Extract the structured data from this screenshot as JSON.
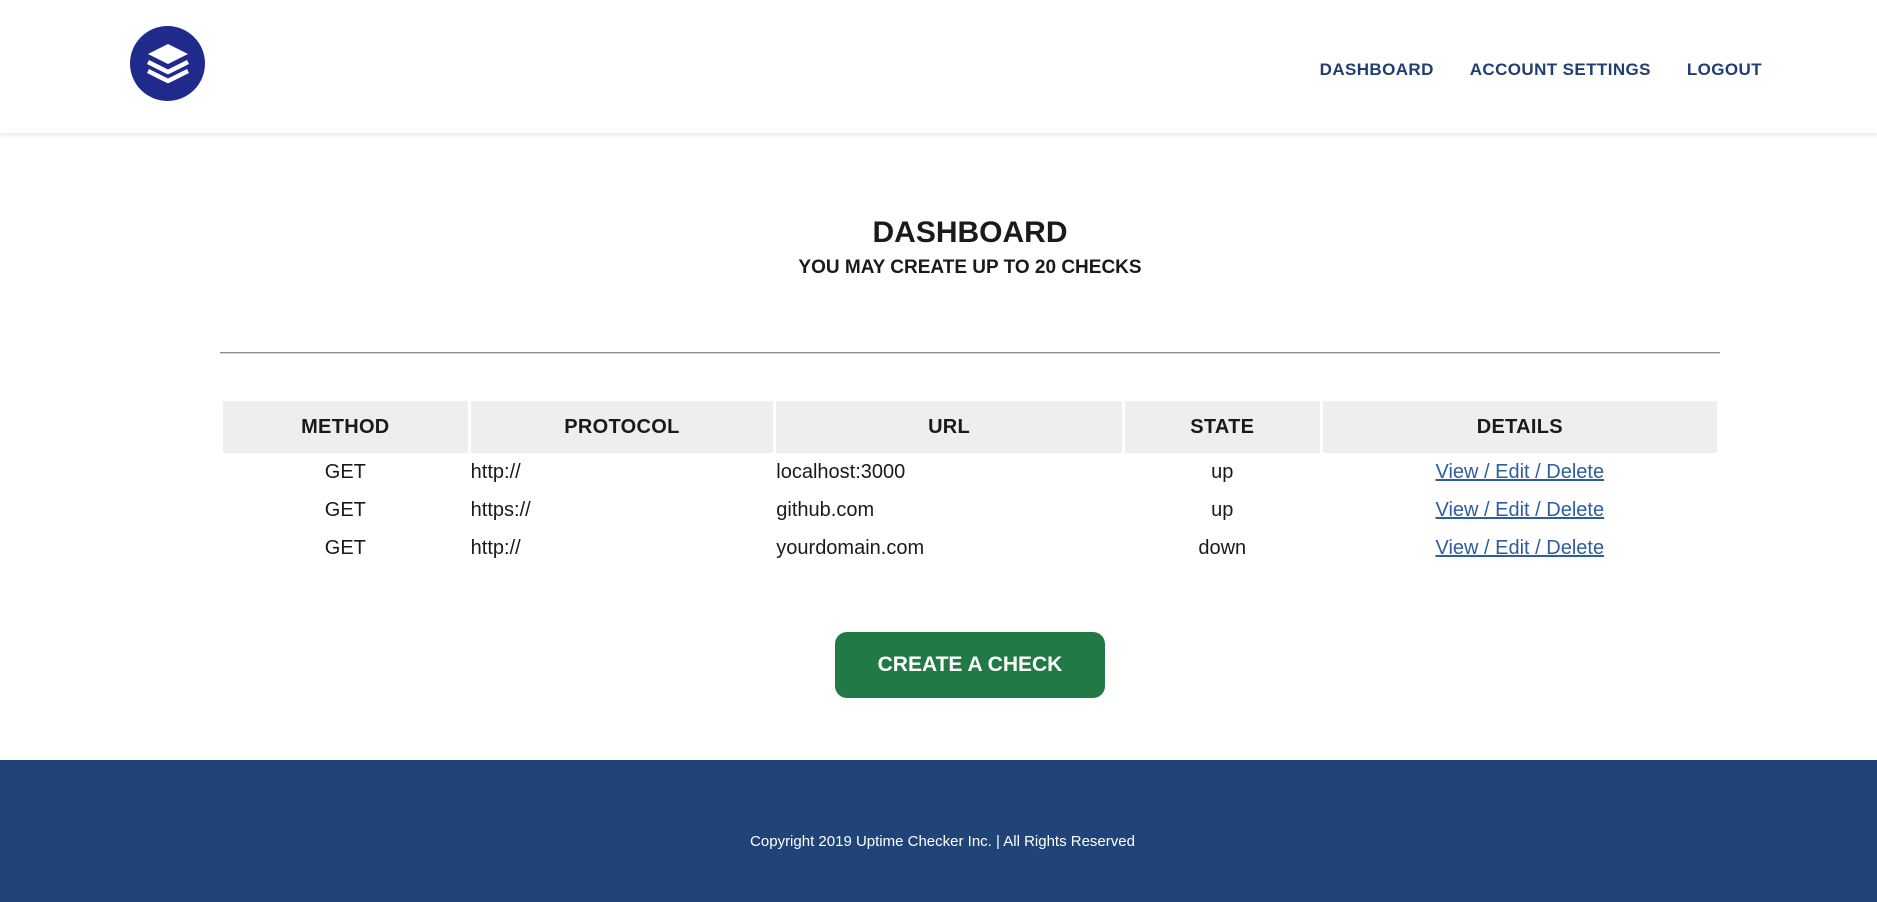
{
  "header": {
    "logo_icon": "stacked-layers-icon",
    "nav": [
      {
        "label": "DASHBOARD"
      },
      {
        "label": "ACCOUNT SETTINGS"
      },
      {
        "label": "LOGOUT"
      }
    ]
  },
  "dashboard": {
    "title": "DASHBOARD",
    "subtitle": "YOU MAY CREATE UP TO 20 CHECKS"
  },
  "table": {
    "headers": [
      "METHOD",
      "PROTOCOL",
      "URL",
      "STATE",
      "DETAILS"
    ],
    "rows": [
      {
        "method": "GET",
        "protocol": "http://",
        "url": "localhost:3000",
        "state": "up",
        "details": "View / Edit / Delete"
      },
      {
        "method": "GET",
        "protocol": "https://",
        "url": "github.com",
        "state": "up",
        "details": "View / Edit / Delete"
      },
      {
        "method": "GET",
        "protocol": "http://",
        "url": "yourdomain.com",
        "state": "down",
        "details": "View / Edit / Delete"
      }
    ]
  },
  "create_button": {
    "label": "CREATE A CHECK"
  },
  "footer": {
    "copyright": "Copyright 2019 Uptime Checker Inc. | All Rights Reserved"
  },
  "colors": {
    "brand": "#1f2a8c",
    "nav_text": "#1f3f73",
    "create_button": "#217a46",
    "footer_bg": "#204378",
    "link": "#2d5da1",
    "table_header_bg": "#eeeeee"
  }
}
